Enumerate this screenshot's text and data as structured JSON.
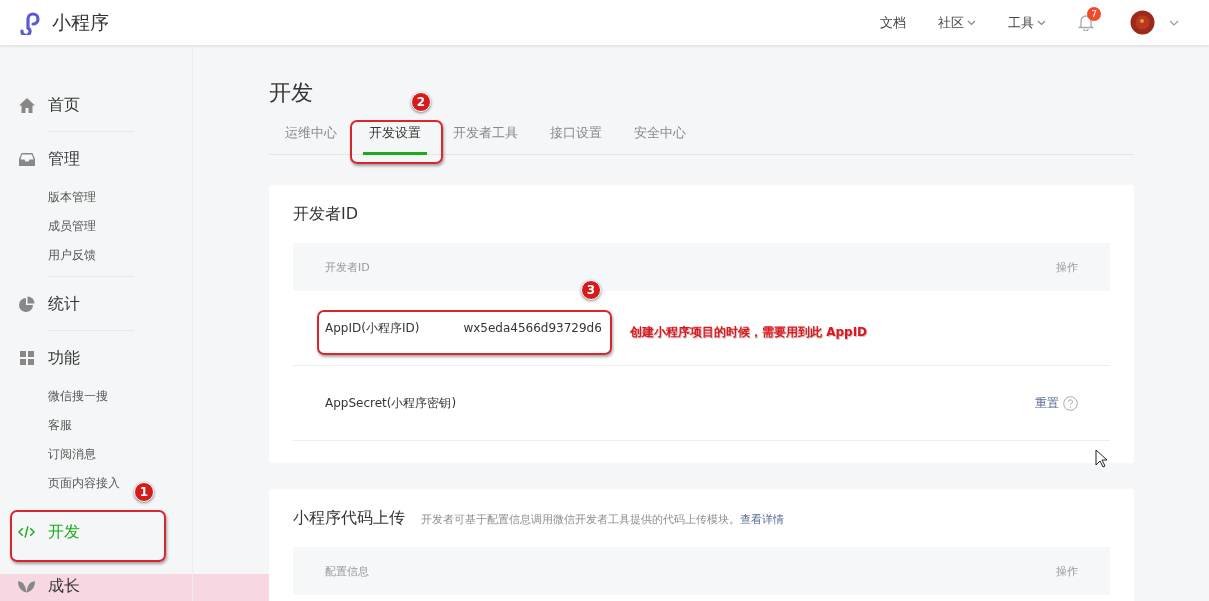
{
  "header": {
    "logo_text": "小程序",
    "nav": [
      {
        "label": "文档",
        "has_menu": false
      },
      {
        "label": "社区",
        "has_menu": true
      },
      {
        "label": "工具",
        "has_menu": true
      }
    ],
    "notifications": {
      "count": "7"
    }
  },
  "sidebar": {
    "items": [
      {
        "label": "首页",
        "kind": "home",
        "selected": false
      },
      {
        "label": "管理",
        "kind": "inbox",
        "selected": false,
        "children": [
          {
            "label": "版本管理",
            "selected": false
          },
          {
            "label": "成员管理",
            "selected": false
          },
          {
            "label": "用户反馈",
            "selected": false
          }
        ]
      },
      {
        "label": "统计",
        "kind": "pie",
        "selected": false
      },
      {
        "label": "功能",
        "kind": "grid",
        "selected": false,
        "children": [
          {
            "label": "微信搜一搜",
            "selected": false
          },
          {
            "label": "客服",
            "selected": false
          },
          {
            "label": "订阅消息",
            "selected": false
          },
          {
            "label": "页面内容接入",
            "selected": false
          }
        ]
      },
      {
        "label": "开发",
        "kind": "code",
        "selected": true
      },
      {
        "label": "成长",
        "kind": "leaf",
        "selected": false
      }
    ]
  },
  "main": {
    "title": "开发",
    "tabs": [
      {
        "label": "运维中心",
        "selected": false
      },
      {
        "label": "开发设置",
        "selected": true
      },
      {
        "label": "开发者工具",
        "selected": false
      },
      {
        "label": "接口设置",
        "selected": false
      },
      {
        "label": "安全中心",
        "selected": false
      }
    ],
    "cards": [
      {
        "title": "开发者ID",
        "table": {
          "columns": [
            "开发者ID",
            "操作"
          ],
          "rows": [
            {
              "label": "AppID(小程序ID)",
              "value": "wx5eda4566d93729d6"
            },
            {
              "label": "AppSecret(小程序密钥)",
              "action": "重置",
              "help": true
            }
          ]
        }
      },
      {
        "title": "小程序代码上传",
        "description": "开发者可基于配置信息调用微信开发者工具提供的代码上传模块。",
        "link": "查看详情",
        "table": {
          "columns": [
            "配置信息",
            "操作"
          ]
        }
      }
    ]
  },
  "annotations": {
    "markers": [
      {
        "number": "1"
      },
      {
        "number": "2"
      },
      {
        "number": "3"
      }
    ],
    "note": "创建小程序项目的时候，需要用到此 AppID"
  }
}
